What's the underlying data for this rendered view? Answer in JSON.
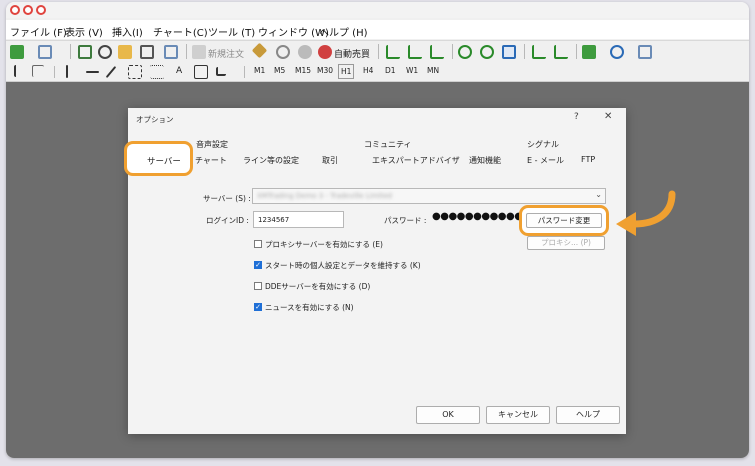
{
  "menu": [
    "ファイル (F)",
    "表示 (V)",
    "挿入(I)",
    "チャート(C)",
    "ツール (T)",
    "ウィンドウ (W)",
    "ヘルプ (H)"
  ],
  "toolbar": {
    "new_order": "新規注文",
    "auto_trade": "自動売買"
  },
  "timeframes": [
    "M1",
    "M5",
    "M15",
    "M30",
    "H1",
    "H4",
    "D1",
    "W1",
    "MN"
  ],
  "dialog": {
    "title": "オプション",
    "help": "?",
    "close": "✕",
    "tabs_row1": [
      "音声設定",
      "コミュニティ",
      "シグナル"
    ],
    "tabs_row2": [
      "サーバー",
      "チャート",
      "ライン等の設定",
      "取引",
      "エキスパートアドバイザ",
      "通知機能",
      "E - メール",
      "FTP"
    ],
    "server_label": "サーバー (S) :",
    "server_value": "XMTrading Demo 3 - Tradeville Limited",
    "login_label": "ログインID :",
    "login_value": "1234567",
    "password_label": "パスワード :",
    "password_value": "●●●●●●●●●●●",
    "change_password": "パスワード変更",
    "proxy_button": "プロキシ... (P)",
    "checkboxes": [
      {
        "label": "プロキシサーバーを有効にする (E)",
        "checked": false
      },
      {
        "label": "スタート時の個人設定とデータを維持する (K)",
        "checked": true
      },
      {
        "label": "DDEサーバーを有効にする (D)",
        "checked": false
      },
      {
        "label": "ニュースを有効にする (N)",
        "checked": true
      }
    ],
    "ok": "OK",
    "cancel": "キャンセル",
    "help_button": "ヘルプ"
  },
  "colors": {
    "highlight": "#f0a030",
    "arrow": "#f0a030",
    "checkbox": "#1f6fd6"
  }
}
